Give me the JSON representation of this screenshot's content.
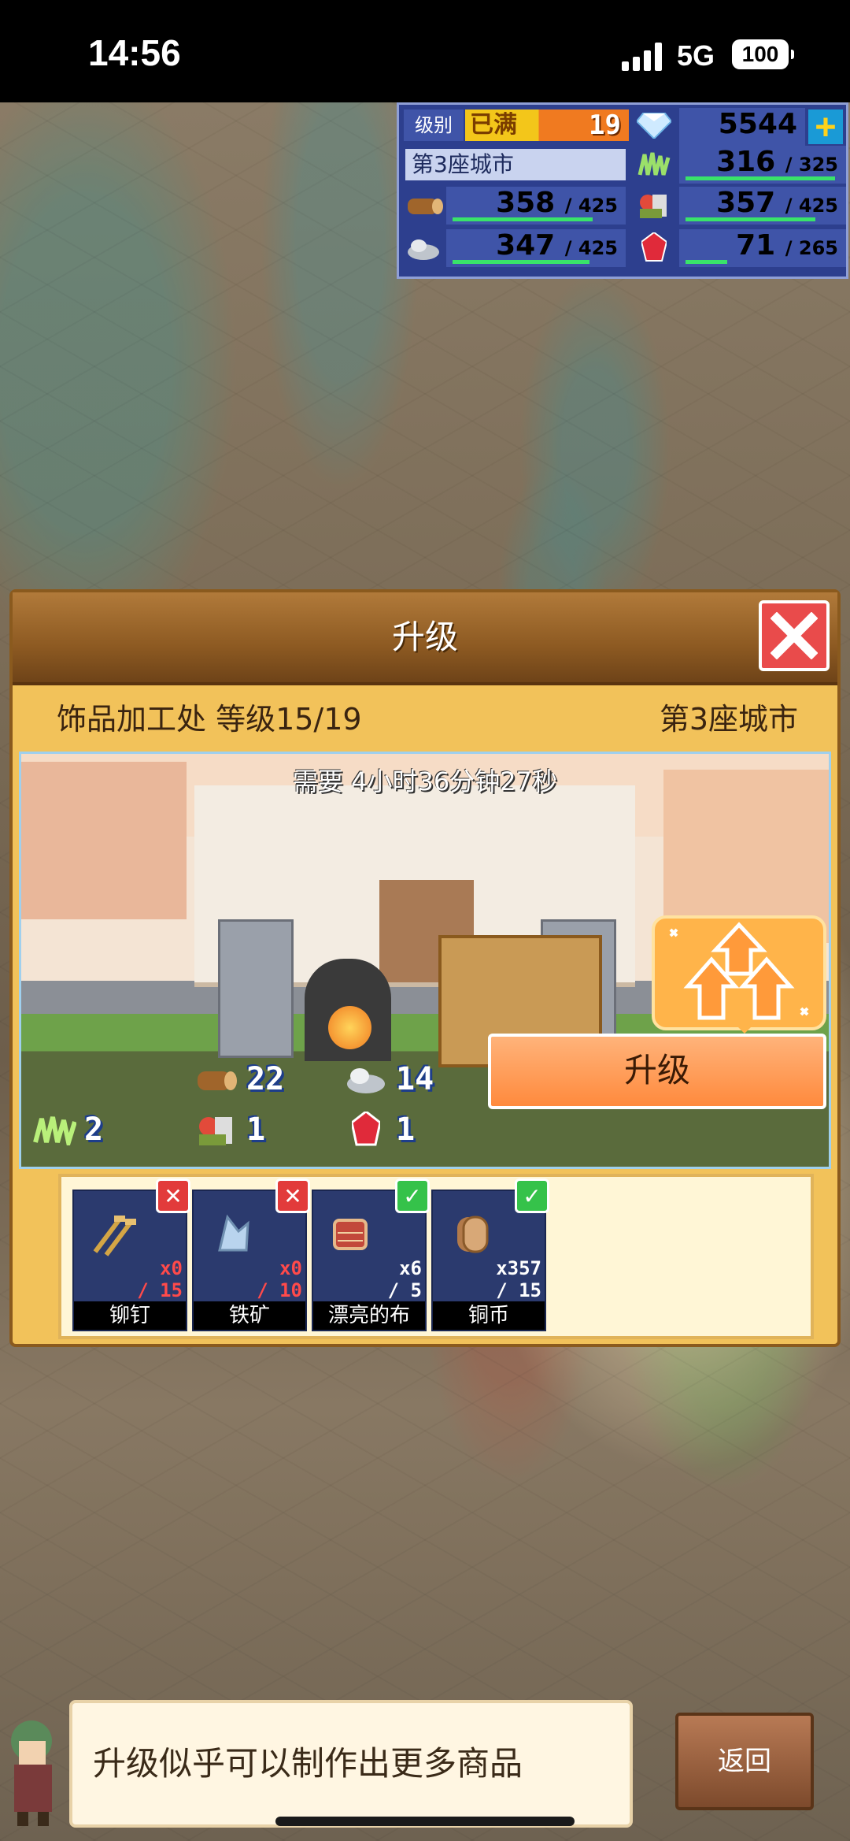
{
  "status_bar": {
    "time": "14:56",
    "network": "5G",
    "battery": "100"
  },
  "hud": {
    "level_label": "级别",
    "level_max_label": "已满",
    "level": "19",
    "gems": "5544",
    "city_name": "第3座城市",
    "resources": [
      {
        "icon": "grass-icon",
        "value": "316",
        "max": "/ 325",
        "fill": 0.97
      },
      {
        "icon": "wood-log-icon",
        "value": "358",
        "max": "/ 425",
        "fill": 0.84
      },
      {
        "icon": "food-basket-icon",
        "value": "357",
        "max": "/ 425",
        "fill": 0.84
      },
      {
        "icon": "stone-icon",
        "value": "347",
        "max": "/ 425",
        "fill": 0.82
      },
      {
        "icon": "ruby-icon",
        "value": "71",
        "max": "/ 265",
        "fill": 0.27
      }
    ]
  },
  "panel": {
    "title": "升级",
    "building": "饰品加工处 等级15/19",
    "city": "第3座城市",
    "time_required": "需要 4小时36分钟27秒",
    "costs": [
      {
        "icon": "wood-log-icon",
        "value": "22"
      },
      {
        "icon": "stone-icon",
        "value": "14"
      },
      {
        "icon": "grass-icon",
        "value": "2"
      },
      {
        "icon": "food-basket-icon",
        "value": "1"
      },
      {
        "icon": "ruby-icon",
        "value": "1"
      }
    ],
    "upgrade_button": "升级",
    "materials": [
      {
        "name": "铆钉",
        "have": "x0",
        "need": "/ 15",
        "ok": false,
        "icon": "rivet-icon"
      },
      {
        "name": "铁矿",
        "have": "x0",
        "need": "/ 10",
        "ok": false,
        "icon": "iron-ore-icon"
      },
      {
        "name": "漂亮的布",
        "have": "x6",
        "need": "/ 5",
        "ok": true,
        "icon": "cloth-icon"
      },
      {
        "name": "铜币",
        "have": "x357",
        "need": "/ 15",
        "ok": true,
        "icon": "copper-coin-icon"
      }
    ]
  },
  "hint": "升级似乎可以制作出更多商品",
  "back_button": "返回",
  "colors": {
    "accent_orange": "#ff8a3d",
    "hud_blue": "#2d3f8e",
    "ok_green": "#35c24a",
    "no_red": "#e23b3b"
  }
}
